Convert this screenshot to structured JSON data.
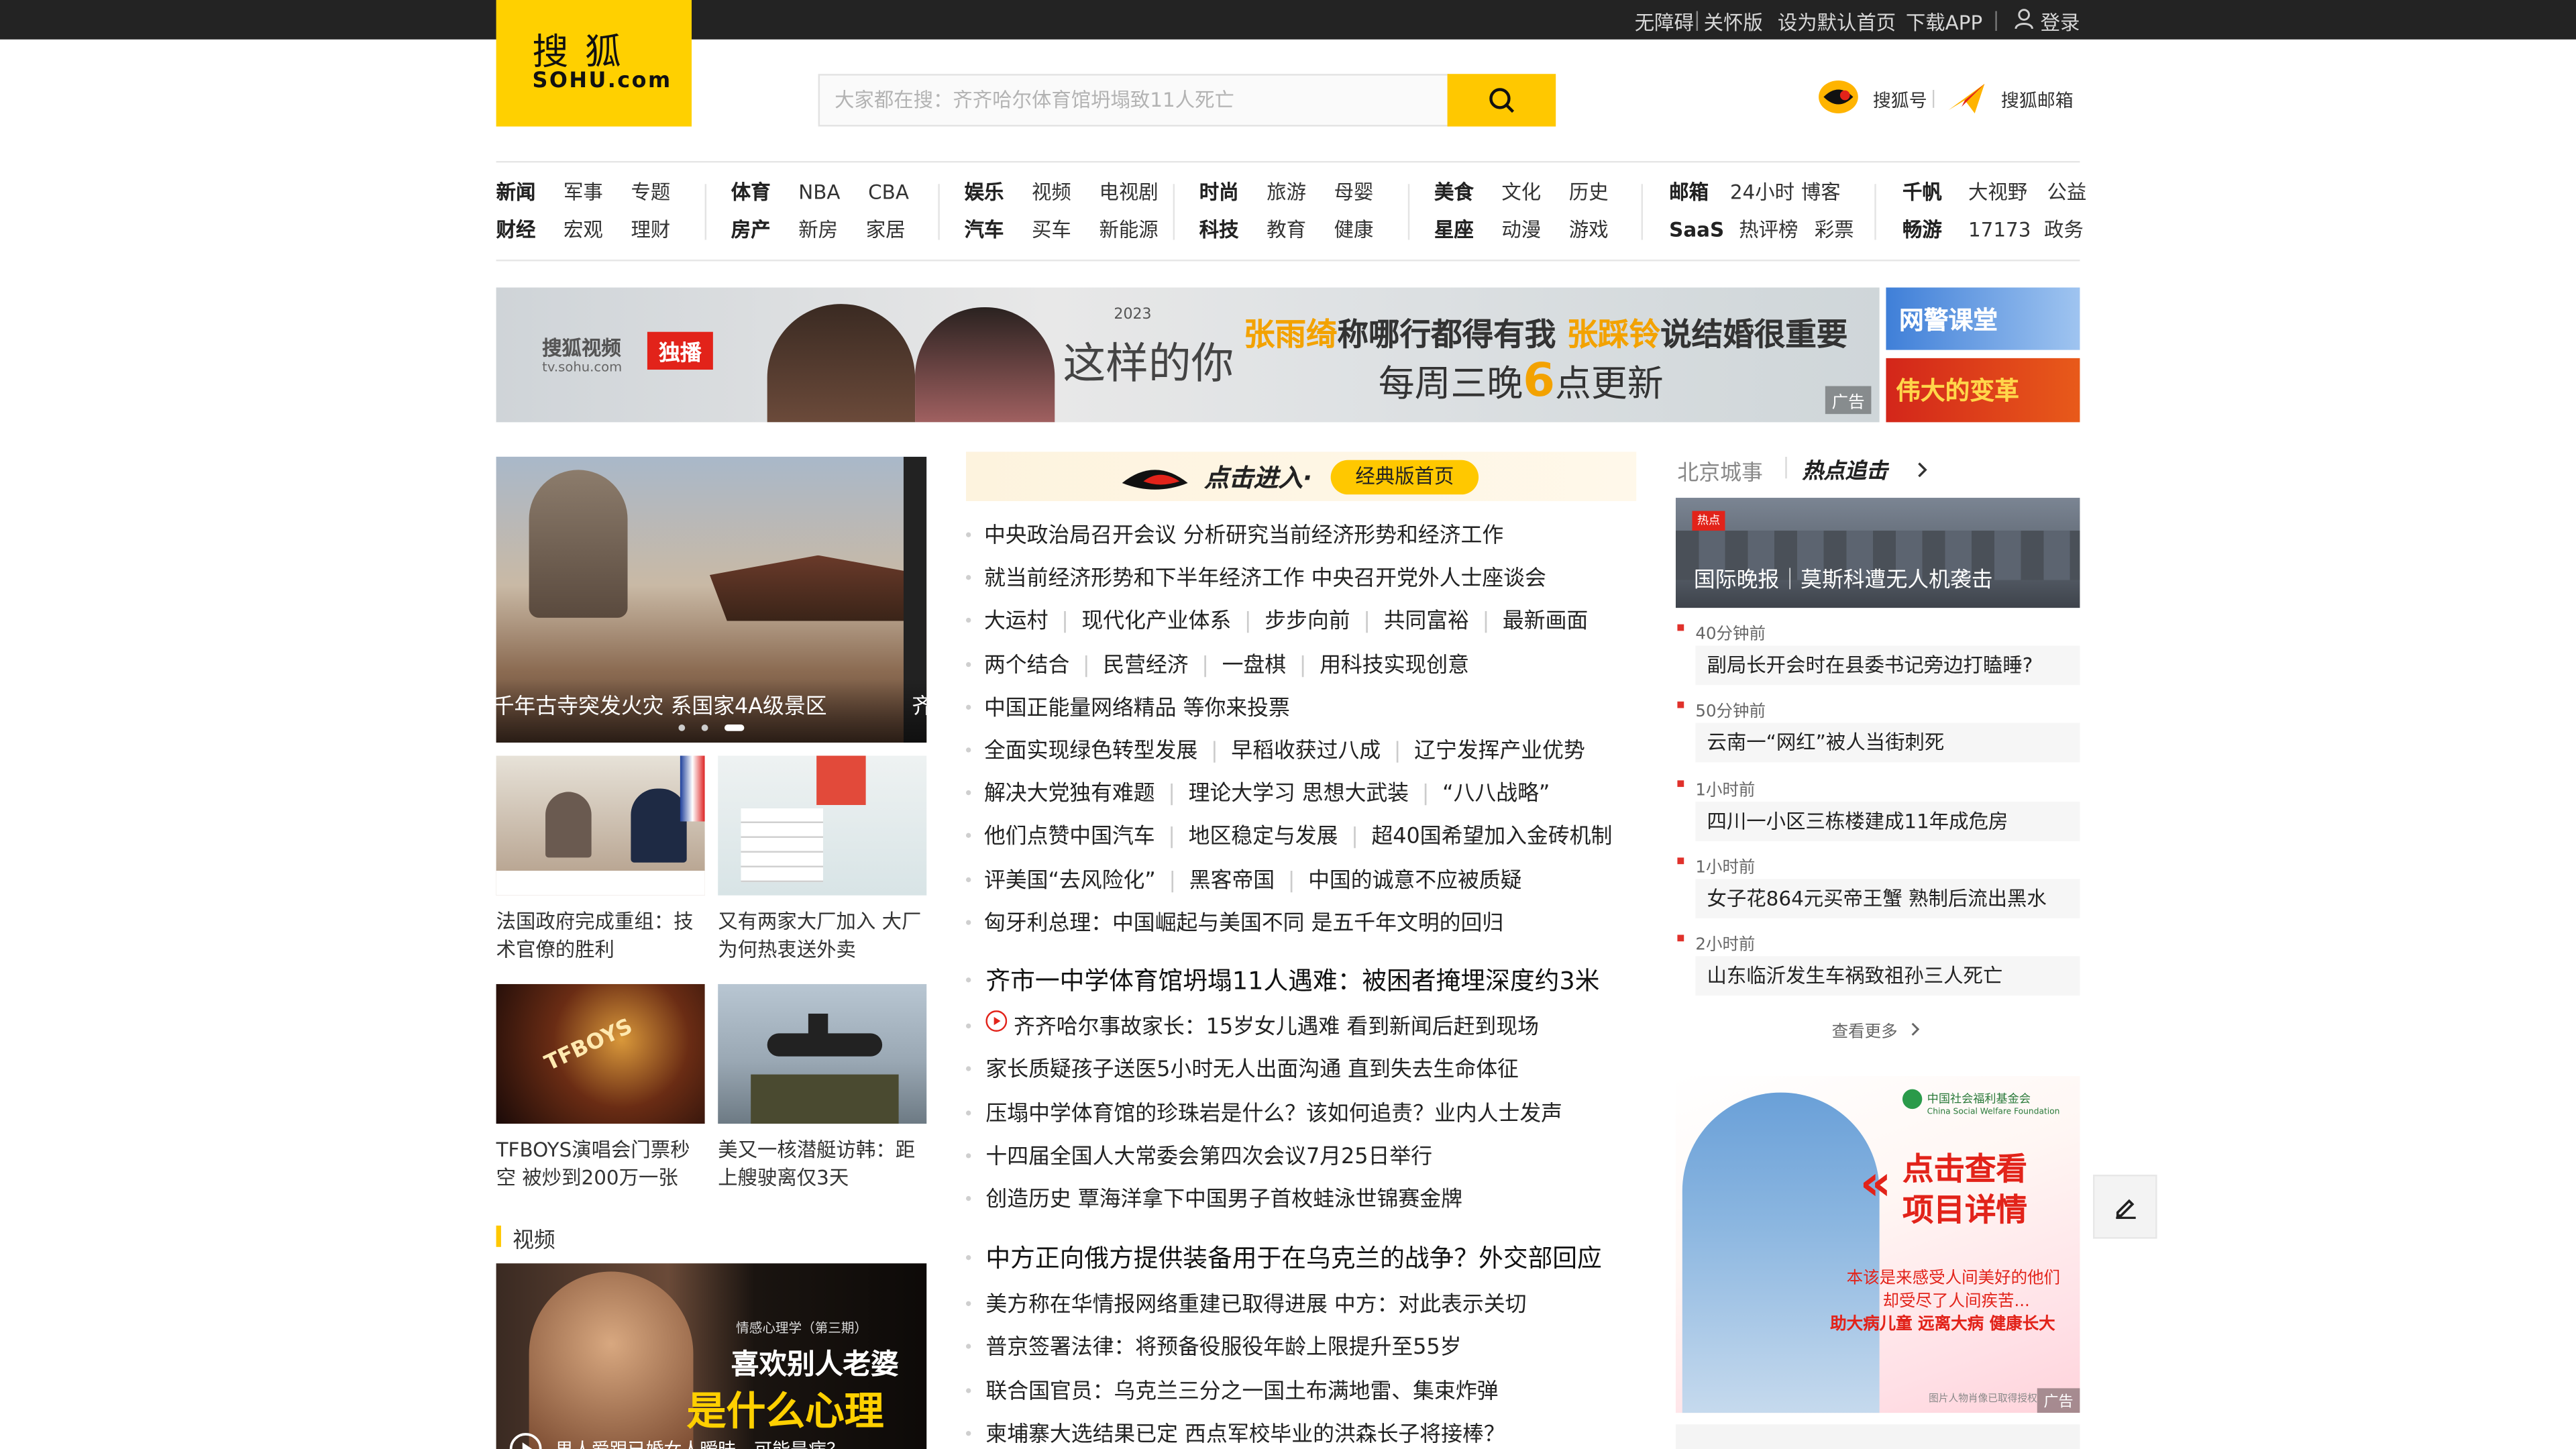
{
  "topbar": {
    "accessibility": "无障碍",
    "care": "关怀版",
    "set_home": "设为默认首页",
    "download_app": "下载APP",
    "login": "登录"
  },
  "logo": {
    "cn": "搜狐",
    "en": "SOHU.com"
  },
  "search": {
    "placeholder": "大家都在搜：齐齐哈尔体育馆坍塌致11人死亡"
  },
  "header_links": {
    "sohu_hao": "搜狐号",
    "sohu_mail": "搜狐邮箱"
  },
  "nav": [
    {
      "row1": [
        "新闻",
        "军事",
        "专题"
      ],
      "row2": [
        "财经",
        "宏观",
        "理财"
      ]
    },
    {
      "row1": [
        "体育",
        "NBA",
        "CBA"
      ],
      "row2": [
        "房产",
        "新房",
        "家居"
      ]
    },
    {
      "row1": [
        "娱乐",
        "视频",
        "电视剧"
      ],
      "row2": [
        "汽车",
        "买车",
        "新能源"
      ]
    },
    {
      "row1": [
        "时尚",
        "旅游",
        "母婴"
      ],
      "row2": [
        "科技",
        "教育",
        "健康"
      ]
    },
    {
      "row1": [
        "美食",
        "文化",
        "历史"
      ],
      "row2": [
        "星座",
        "动漫",
        "游戏"
      ]
    },
    {
      "row1": [
        "邮箱",
        "24小时",
        "博客"
      ],
      "row2": [
        "SaaS",
        "热评榜",
        "彩票"
      ]
    },
    {
      "row1": [
        "千帆",
        "大视野",
        "公益"
      ],
      "row2": [
        "畅游",
        "17173",
        "政务"
      ]
    }
  ],
  "banner": {
    "brand": "搜狐视频",
    "brand_url": "tv.sohu.com",
    "exclusive": "独播",
    "show_year": "2023",
    "show_title": "这样的你",
    "line1_a": "张雨绮",
    "line1_b": "称哪行都得有我",
    "line1_c": "张踩铃",
    "line1_d": "说结婚很重要",
    "line2_a": "每周三晚",
    "line2_b": "6",
    "line2_c": "点更新",
    "ad": "广告",
    "side1": "网警课堂",
    "side2": "伟大的变革"
  },
  "carousel": {
    "caption": "千年古寺突发火灾 系国家4A级景区",
    "caption_next": "齐"
  },
  "thumbs": [
    {
      "caption": "法国政府完成重组：技术官僚的胜利"
    },
    {
      "caption": "又有两家大厂加入 大厂为何热衷送外卖"
    },
    {
      "caption": "TFBOYS演唱会门票秒空 被炒到200万一张"
    },
    {
      "caption": "美又一核潜艇访韩：距上艘驶离仅3天"
    }
  ],
  "video_section": {
    "title": "视频",
    "poster_sub": "情感心理学（第三期）",
    "poster_line1": "喜欢别人老婆",
    "poster_line2": "是什么心理",
    "poster_caption": "男人爱跟已婚女人暧昧，可能是病？"
  },
  "classic": {
    "enter": "点击进入·",
    "label": "经典版首页"
  },
  "news_lines": [
    [
      "中央政治局召开会议 分析研究当前经济形势和经济工作"
    ],
    [
      "就当前经济形势和下半年经济工作 中央召开党外人士座谈会"
    ],
    [
      "大运村",
      "现代化产业体系",
      "步步向前",
      "共同富裕",
      "最新画面"
    ],
    [
      "两个结合",
      "民营经济",
      "一盘棋",
      "用科技实现创意"
    ],
    [
      "中国正能量网络精品 等你来投票"
    ],
    [
      "全面实现绿色转型发展",
      "早稻收获过八成",
      "辽宁发挥产业优势"
    ],
    [
      "解决大党独有难题",
      "理论大学习 思想大武装",
      "“八八战略”"
    ],
    [
      "他们点赞中国汽车",
      "地区稳定与发展",
      "超40国希望加入金砖机制"
    ],
    [
      "评美国“去风险化”",
      "黑客帝国",
      "中国的诚意不应被质疑"
    ],
    [
      "匈牙利总理：中国崛起与美国不同 是五千年文明的回归"
    ]
  ],
  "block2": {
    "headline": "齐市一中学体育馆坍塌11人遇难：被困者掩埋深度约3米",
    "items": [
      "齐齐哈尔事故家长：15岁女儿遇难 看到新闻后赶到现场",
      "家长质疑孩子送医5小时无人出面沟通 直到失去生命体征",
      "压塌中学体育馆的珍珠岩是什么？该如何追责？业内人士发声",
      "十四届全国人大常委会第四次会议7月25日举行",
      "创造历史 覃海洋拿下中国男子首枚蛙泳世锦赛金牌"
    ]
  },
  "block3": {
    "headline": "中方正向俄方提供装备用于在乌克兰的战争？外交部回应",
    "items": [
      "美方称在华情报网络重建已取得进展 中方：对此表示关切",
      "普京签署法律：将预备役服役年龄上限提升至55岁",
      "联合国官员：乌克兰三分之一国土布满地雷、集束炸弹",
      "柬埔寨大选结果已定 西点军校毕业的洪森长子将接棒？"
    ]
  },
  "right": {
    "city": "北京城事",
    "hot": "热点追击",
    "hotpic_tag": "热点",
    "hotpic_caption": "国际晚报｜莫斯科遭无人机袭击",
    "items": [
      {
        "time": "40分钟前",
        "title": "副局长开会时在县委书记旁边打瞌睡?"
      },
      {
        "time": "50分钟前",
        "title": "云南一“网红”被人当街刺死"
      },
      {
        "time": "1小时前",
        "title": "四川一小区三栋楼建成11年成危房"
      },
      {
        "time": "1小时前",
        "title": "女子花864元买帝王蟹 熟制后流出黑水"
      },
      {
        "time": "2小时前",
        "title": "山东临沂发生车祸致祖孙三人死亡"
      }
    ],
    "more": "查看更多",
    "charity_org": "中国社会福利基金会",
    "charity_org_en": "China Social Welfare Foundation",
    "charity_cta1": "点击查看",
    "charity_cta2": "项目详情",
    "charity_text1": "本该是来感受人间美好的他们",
    "charity_text2": "却受尽了人间疾苦...",
    "charity_text3": "助大病儿童 远离大病 健康长大",
    "charity_note": "图片人物肖像已取得授权",
    "ad": "广告"
  },
  "colors": {
    "brand_yellow": "#ffd000",
    "search_yellow": "#ffc800",
    "topbar": "#232323",
    "hot_red": "#e0312b"
  }
}
